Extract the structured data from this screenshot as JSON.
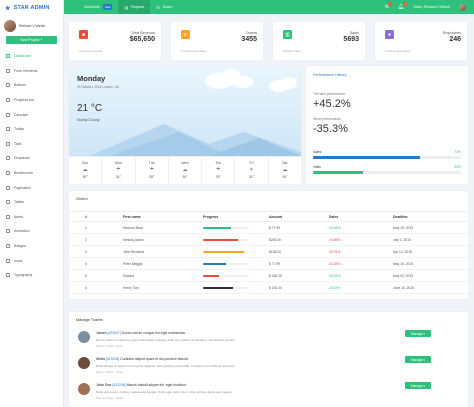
{
  "brand": {
    "name": "STAR ADMIN"
  },
  "user": {
    "name": "Richard V.Welsh",
    "subtitle": ""
  },
  "sidebar": {
    "new_project": "New Project +",
    "items": [
      "Dashboard",
      "Form elements",
      "Buttons",
      "Progress bar",
      "Carousel",
      "Tooltip",
      "Tabs",
      "Dropdown",
      "Breadcrumb",
      "Pagination",
      "Tables",
      "Alerts",
      "Animation",
      "Badges",
      "Icons",
      "Typography"
    ]
  },
  "topbar": {
    "nav": [
      {
        "label": "Schedule",
        "badge": "New"
      },
      {
        "label": "Reports"
      },
      {
        "label": "Score"
      }
    ],
    "notif_count_1": "7",
    "notif_count_2": "4",
    "greeting": "Hello, Richard V.Welsh"
  },
  "stats": [
    {
      "label": "Total Revenue",
      "value": "$65,650",
      "foot": "Last week growth",
      "color": "#e74c3c",
      "icon": "cube-icon"
    },
    {
      "label": "Orders",
      "value": "3455",
      "foot": "Product-wise sales",
      "color": "#f5a623",
      "icon": "receipt-icon"
    },
    {
      "label": "Sales",
      "value": "5693",
      "foot": "Weekly Sales",
      "color": "#2ec17b",
      "icon": "chart-icon"
    },
    {
      "label": "Employees",
      "value": "246",
      "foot": "Product-wise sales",
      "color": "#8a6fd1",
      "icon": "account-icon"
    }
  ],
  "weather": {
    "day": "Monday",
    "date": "25 October, 2016 London, UK",
    "temp": "21 °C",
    "cond": "Mostly Cloudy",
    "forecast": [
      {
        "d": "Sun",
        "t": "30°"
      },
      {
        "d": "Mon",
        "t": "31°"
      },
      {
        "d": "Tue",
        "t": "28°"
      },
      {
        "d": "Wed",
        "t": "30°"
      },
      {
        "d": "Thu",
        "t": "29°"
      },
      {
        "d": "Fri",
        "t": "31°"
      },
      {
        "d": "Sat",
        "t": "30°"
      }
    ]
  },
  "performance": {
    "title": "Performance History",
    "best_label": "The best performance",
    "best_value": "+45.2%",
    "worst_label": "Worst performance",
    "worst_value": "-35.3%",
    "bars": [
      {
        "label": "Sales",
        "pct": "72%",
        "fill": 0.72,
        "color": "#2b77c8"
      },
      {
        "label": "Visits",
        "pct": "34%",
        "fill": 0.34,
        "color": "#2ec17b"
      }
    ]
  },
  "orders": {
    "title": "Orders",
    "headers": [
      "#",
      "First name",
      "Progress",
      "Amount",
      "Sales",
      "Deadline"
    ],
    "rows": [
      {
        "n": "1",
        "name": "Herman Beck",
        "fill": 0.6,
        "color": "#2ec17b",
        "amount": "$ 77.99",
        "sales": "53.64%",
        "up": true,
        "deadline": "May 15, 2015"
      },
      {
        "n": "2",
        "name": "Messsy Adam",
        "fill": 0.75,
        "color": "#e74c3c",
        "amount": "$245.30",
        "sales": "24.56%",
        "up": false,
        "deadline": "July 1, 2015"
      },
      {
        "n": "3",
        "name": "John Richards",
        "fill": 0.9,
        "color": "#f5a623",
        "amount": "$138.00",
        "sales": "28.76%",
        "up": false,
        "deadline": "Apr 12, 2015"
      },
      {
        "n": "4",
        "name": "Peter Meggik",
        "fill": 0.5,
        "color": "#2b77c8",
        "amount": "$ 77.99",
        "sales": "53.45%",
        "up": false,
        "deadline": "May 15, 2015"
      },
      {
        "n": "5",
        "name": "Edward",
        "fill": 0.35,
        "color": "#e74c3c",
        "amount": "$ 160.25",
        "sales": "18.32%",
        "up": true,
        "deadline": "May 03, 2015"
      },
      {
        "n": "6",
        "name": "Henry Tom",
        "fill": 0.65,
        "color": "#333333",
        "amount": "$ 150.00",
        "sales": "24.67%",
        "up": true,
        "deadline": "June 16, 2015"
      }
    ]
  },
  "tickets": {
    "title": "Manage Tickets",
    "manage": "Manage",
    "items": [
      {
        "name": "James",
        "id": "[#23047]",
        "subject": "Donec rutrum congue leo eget malesuada.",
        "text": "Donec rutrum congue leo eget malesuada. Quisque velit nisi, pretium ut lacinia in, elementum id enim.",
        "meta": "Due in 2 Days · Open",
        "avatar": "#7b8fa3"
      },
      {
        "name": "Stella",
        "id": "[#23135]",
        "subject": "Curabitur aliquet quam id dui posuere blandit.",
        "text": "Pellentesque in ipsum id orci porta dapibus. Sed porttitor lectus nibh. Curabitur non nulla sit amet nisl.",
        "meta": "Due in 3 Days · Open",
        "avatar": "#6f4a3a"
      },
      {
        "name": "John Doe",
        "id": "[#23246]",
        "subject": "Mauris blandit aliquet elit, eget tincidunt.",
        "text": "Nulla quis lorem ut libero malesuada feugiat. Proin eget tortor risus. Cras ultricies ligula sed magna.",
        "meta": "Due in 4 Days · Open",
        "avatar": "#a06f55"
      }
    ]
  }
}
